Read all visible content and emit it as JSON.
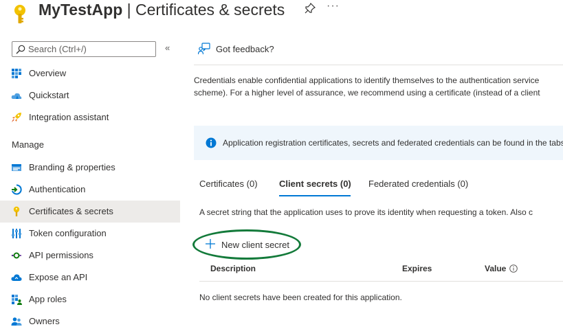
{
  "header": {
    "app_name": "MyTestApp",
    "separator": " | ",
    "page_title": "Certificates & secrets",
    "more_label": "···"
  },
  "sidebar": {
    "search_placeholder": "Search (Ctrl+/)",
    "collapse_label": "«",
    "top_items": [
      {
        "label": "Overview",
        "icon": "overview-icon"
      },
      {
        "label": "Quickstart",
        "icon": "quickstart-icon"
      },
      {
        "label": "Integration assistant",
        "icon": "rocket-icon"
      }
    ],
    "section_title": "Manage",
    "manage_items": [
      {
        "label": "Branding & properties",
        "icon": "branding-icon"
      },
      {
        "label": "Authentication",
        "icon": "authentication-icon"
      },
      {
        "label": "Certificates & secrets",
        "icon": "key-icon",
        "active": true
      },
      {
        "label": "Token configuration",
        "icon": "token-icon"
      },
      {
        "label": "API permissions",
        "icon": "api-permissions-icon"
      },
      {
        "label": "Expose an API",
        "icon": "cloud-icon"
      },
      {
        "label": "App roles",
        "icon": "app-roles-icon"
      },
      {
        "label": "Owners",
        "icon": "owners-icon"
      }
    ]
  },
  "main": {
    "feedback_label": "Got feedback?",
    "description_line1": "Credentials enable confidential applications to identify themselves to the authentication service",
    "description_line2": "scheme). For a higher level of assurance, we recommend using a certificate (instead of a client",
    "info_text": "Application registration certificates, secrets and federated credentials can be found in the tabs",
    "tabs": [
      {
        "label": "Certificates (0)"
      },
      {
        "label": "Client secrets (0)",
        "active": true
      },
      {
        "label": "Federated credentials (0)"
      }
    ],
    "secret_description": "A secret string that the application uses to prove its identity when requesting a token. Also c",
    "new_button_label": "New client secret",
    "table": {
      "columns": [
        "Description",
        "Expires",
        "Value"
      ],
      "empty_message": "No client secrets have been created for this application."
    }
  },
  "colors": {
    "accent": "#0078d4",
    "highlight_circle": "#137a3a",
    "key_yellow": "#f2c200",
    "info_background": "#eff6fc"
  }
}
